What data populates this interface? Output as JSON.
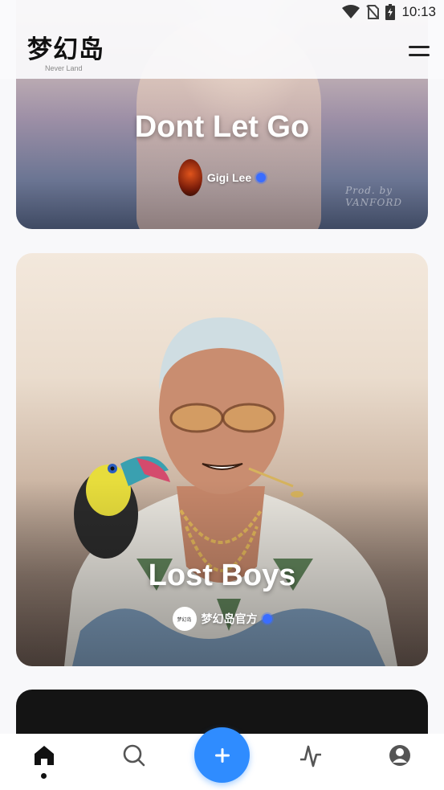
{
  "status_bar": {
    "time": "10:13",
    "icons": [
      "wifi-icon",
      "no-sim-icon",
      "battery-charging-icon"
    ]
  },
  "header": {
    "logo_text": "梦幻岛",
    "logo_subtitle": "Never Land",
    "menu_icon": "menu-icon"
  },
  "feed": [
    {
      "title": "Dont Let Go",
      "artist": "Gigi Lee",
      "verified": true,
      "cover_text": [
        "Prod. by",
        "VANFORD"
      ]
    },
    {
      "title": "Lost Boys",
      "artist": "梦幻岛官方",
      "verified": true,
      "avatar_text": "梦幻岛"
    },
    {
      "title": "",
      "artist": ""
    }
  ],
  "bottom_nav": {
    "items": [
      "home-icon",
      "search-icon",
      "add-icon",
      "activity-icon",
      "profile-icon"
    ],
    "active": "home-icon"
  },
  "colors": {
    "accent": "#2f8cff",
    "verified": "#3a6dff"
  }
}
